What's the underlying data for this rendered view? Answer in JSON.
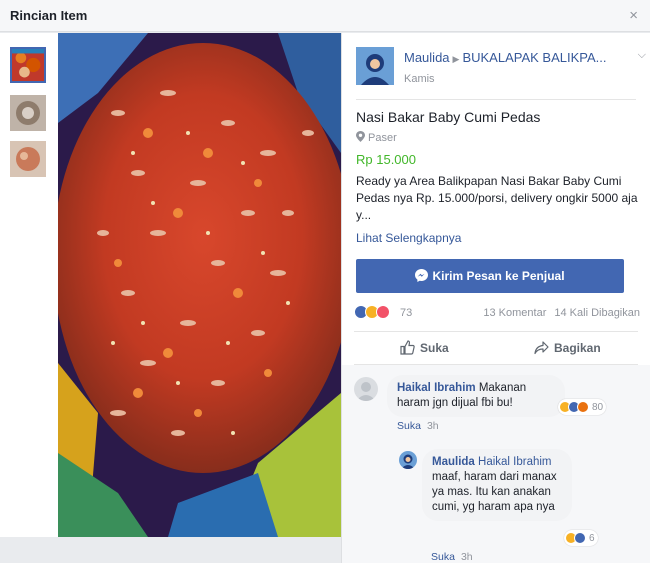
{
  "dialog": {
    "title": "Rincian Item",
    "close_glyph": "×"
  },
  "thumbnails": [
    {
      "name": "thumb-1",
      "active": true
    },
    {
      "name": "thumb-2",
      "active": false
    },
    {
      "name": "thumb-3",
      "active": false
    }
  ],
  "post": {
    "author": "Maulida",
    "group": "BUKALAPAK BALIKPA...",
    "date": "Kamis",
    "title": "Nasi Bakar Baby Cumi Pedas",
    "location": "Paser",
    "price": "Rp 15.000",
    "description": "Ready ya Area Balikpapan Nasi Bakar Baby Cumi Pedas nya Rp. 15.000/porsi, delivery ongkir 5000 aja y...",
    "see_more": "Lihat Selengkapnya",
    "message_button": "Kirim Pesan ke Penjual"
  },
  "reactions": {
    "count": "73",
    "comments": "13 Komentar",
    "shares": "14 Kali Dibagikan",
    "icons": [
      "like-icon",
      "haha-icon",
      "love-icon"
    ]
  },
  "actions": {
    "like": "Suka",
    "share": "Bagikan"
  },
  "comments": [
    {
      "author": "Haikal Ibrahim",
      "text": "Makanan haram jgn dijual fbi bu!",
      "reaction_count": "80",
      "like_label": "Suka",
      "time": "3h"
    },
    {
      "author": "Maulida",
      "mention": "Haikal Ibrahim",
      "text": "maaf, haram dari manax ya mas. Itu kan anakan cumi, yg haram apa nya",
      "reaction_count": "6",
      "like_label": "Suka",
      "time": "3h"
    }
  ],
  "colors": {
    "brand_blue": "#4267b2",
    "link_blue": "#365899",
    "price_green": "#42b72a",
    "muted": "#90949c"
  }
}
